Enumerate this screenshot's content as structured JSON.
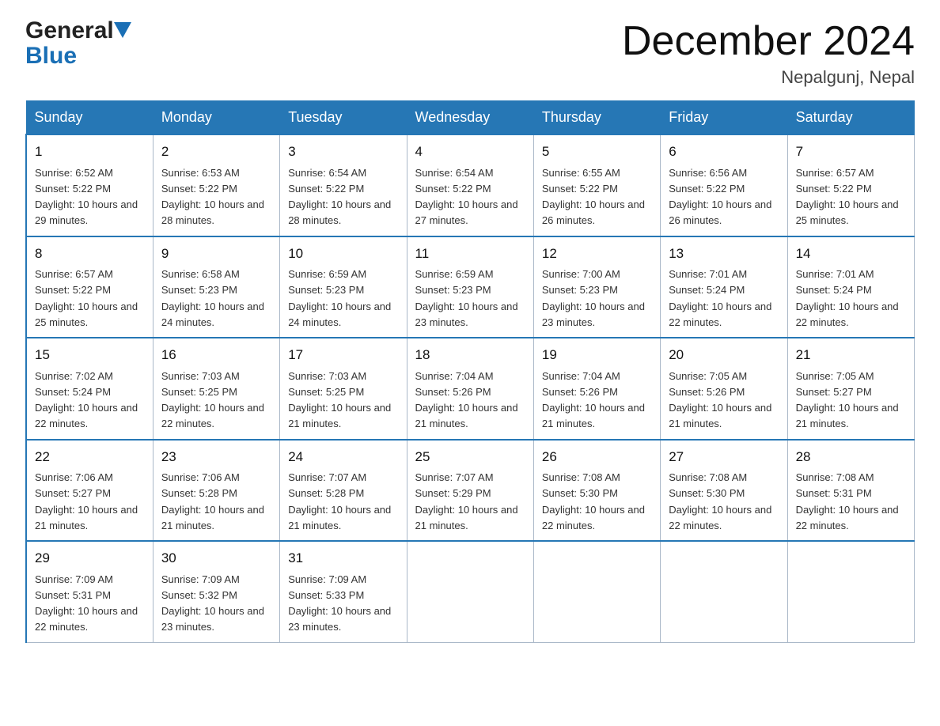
{
  "logo": {
    "line1": "General",
    "line2": "Blue",
    "tagline": ""
  },
  "title": "December 2024",
  "subtitle": "Nepalgunj, Nepal",
  "days_of_week": [
    "Sunday",
    "Monday",
    "Tuesday",
    "Wednesday",
    "Thursday",
    "Friday",
    "Saturday"
  ],
  "weeks": [
    [
      {
        "day": "1",
        "sunrise": "6:52 AM",
        "sunset": "5:22 PM",
        "daylight": "10 hours and 29 minutes."
      },
      {
        "day": "2",
        "sunrise": "6:53 AM",
        "sunset": "5:22 PM",
        "daylight": "10 hours and 28 minutes."
      },
      {
        "day": "3",
        "sunrise": "6:54 AM",
        "sunset": "5:22 PM",
        "daylight": "10 hours and 28 minutes."
      },
      {
        "day": "4",
        "sunrise": "6:54 AM",
        "sunset": "5:22 PM",
        "daylight": "10 hours and 27 minutes."
      },
      {
        "day": "5",
        "sunrise": "6:55 AM",
        "sunset": "5:22 PM",
        "daylight": "10 hours and 26 minutes."
      },
      {
        "day": "6",
        "sunrise": "6:56 AM",
        "sunset": "5:22 PM",
        "daylight": "10 hours and 26 minutes."
      },
      {
        "day": "7",
        "sunrise": "6:57 AM",
        "sunset": "5:22 PM",
        "daylight": "10 hours and 25 minutes."
      }
    ],
    [
      {
        "day": "8",
        "sunrise": "6:57 AM",
        "sunset": "5:22 PM",
        "daylight": "10 hours and 25 minutes."
      },
      {
        "day": "9",
        "sunrise": "6:58 AM",
        "sunset": "5:23 PM",
        "daylight": "10 hours and 24 minutes."
      },
      {
        "day": "10",
        "sunrise": "6:59 AM",
        "sunset": "5:23 PM",
        "daylight": "10 hours and 24 minutes."
      },
      {
        "day": "11",
        "sunrise": "6:59 AM",
        "sunset": "5:23 PM",
        "daylight": "10 hours and 23 minutes."
      },
      {
        "day": "12",
        "sunrise": "7:00 AM",
        "sunset": "5:23 PM",
        "daylight": "10 hours and 23 minutes."
      },
      {
        "day": "13",
        "sunrise": "7:01 AM",
        "sunset": "5:24 PM",
        "daylight": "10 hours and 22 minutes."
      },
      {
        "day": "14",
        "sunrise": "7:01 AM",
        "sunset": "5:24 PM",
        "daylight": "10 hours and 22 minutes."
      }
    ],
    [
      {
        "day": "15",
        "sunrise": "7:02 AM",
        "sunset": "5:24 PM",
        "daylight": "10 hours and 22 minutes."
      },
      {
        "day": "16",
        "sunrise": "7:03 AM",
        "sunset": "5:25 PM",
        "daylight": "10 hours and 22 minutes."
      },
      {
        "day": "17",
        "sunrise": "7:03 AM",
        "sunset": "5:25 PM",
        "daylight": "10 hours and 21 minutes."
      },
      {
        "day": "18",
        "sunrise": "7:04 AM",
        "sunset": "5:26 PM",
        "daylight": "10 hours and 21 minutes."
      },
      {
        "day": "19",
        "sunrise": "7:04 AM",
        "sunset": "5:26 PM",
        "daylight": "10 hours and 21 minutes."
      },
      {
        "day": "20",
        "sunrise": "7:05 AM",
        "sunset": "5:26 PM",
        "daylight": "10 hours and 21 minutes."
      },
      {
        "day": "21",
        "sunrise": "7:05 AM",
        "sunset": "5:27 PM",
        "daylight": "10 hours and 21 minutes."
      }
    ],
    [
      {
        "day": "22",
        "sunrise": "7:06 AM",
        "sunset": "5:27 PM",
        "daylight": "10 hours and 21 minutes."
      },
      {
        "day": "23",
        "sunrise": "7:06 AM",
        "sunset": "5:28 PM",
        "daylight": "10 hours and 21 minutes."
      },
      {
        "day": "24",
        "sunrise": "7:07 AM",
        "sunset": "5:28 PM",
        "daylight": "10 hours and 21 minutes."
      },
      {
        "day": "25",
        "sunrise": "7:07 AM",
        "sunset": "5:29 PM",
        "daylight": "10 hours and 21 minutes."
      },
      {
        "day": "26",
        "sunrise": "7:08 AM",
        "sunset": "5:30 PM",
        "daylight": "10 hours and 22 minutes."
      },
      {
        "day": "27",
        "sunrise": "7:08 AM",
        "sunset": "5:30 PM",
        "daylight": "10 hours and 22 minutes."
      },
      {
        "day": "28",
        "sunrise": "7:08 AM",
        "sunset": "5:31 PM",
        "daylight": "10 hours and 22 minutes."
      }
    ],
    [
      {
        "day": "29",
        "sunrise": "7:09 AM",
        "sunset": "5:31 PM",
        "daylight": "10 hours and 22 minutes."
      },
      {
        "day": "30",
        "sunrise": "7:09 AM",
        "sunset": "5:32 PM",
        "daylight": "10 hours and 23 minutes."
      },
      {
        "day": "31",
        "sunrise": "7:09 AM",
        "sunset": "5:33 PM",
        "daylight": "10 hours and 23 minutes."
      },
      null,
      null,
      null,
      null
    ]
  ]
}
